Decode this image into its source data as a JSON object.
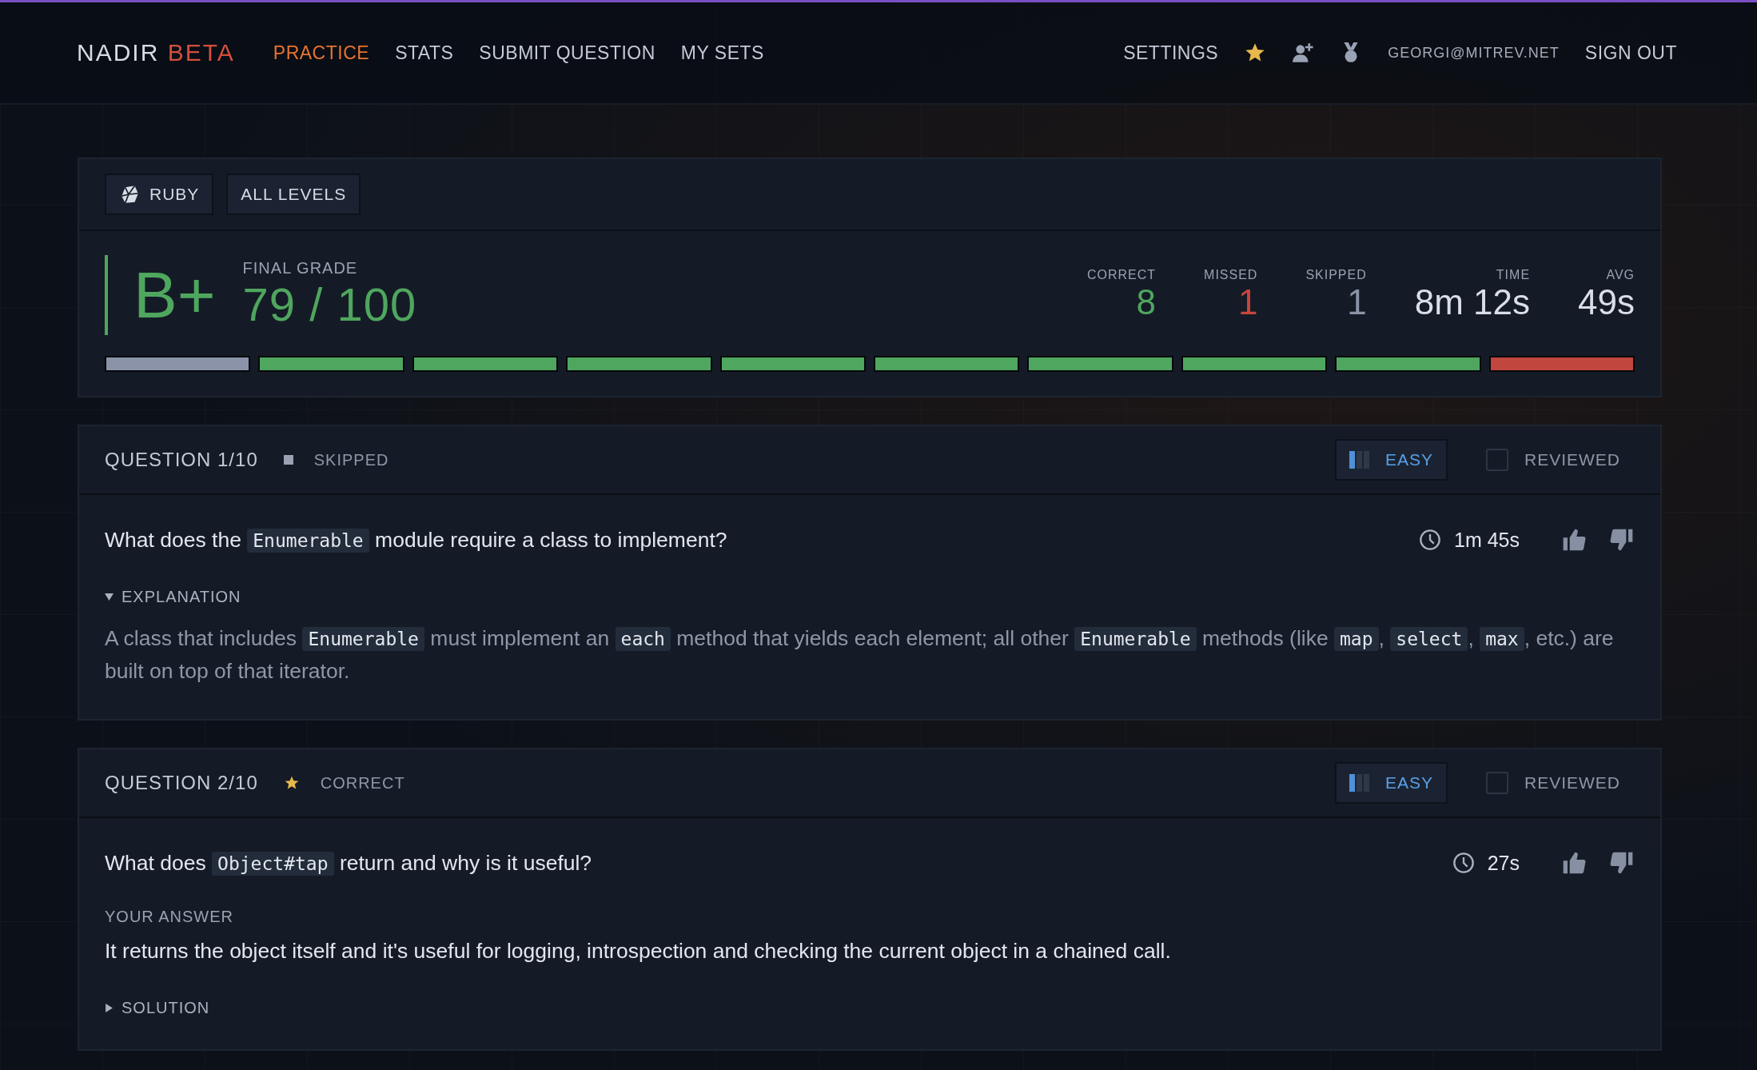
{
  "header": {
    "logo": "NADIR",
    "logo_tag": "BETA",
    "nav": [
      {
        "label": "PRACTICE",
        "selected": true
      },
      {
        "label": "STATS",
        "selected": false
      },
      {
        "label": "SUBMIT QUESTION",
        "selected": false
      },
      {
        "label": "MY SETS",
        "selected": false
      }
    ],
    "settings": "SETTINGS",
    "email": "GEORGI@MITREV.NET",
    "sign_out": "SIGN OUT"
  },
  "summary": {
    "filters": [
      {
        "label": "RUBY",
        "kind": "language"
      },
      {
        "label": "ALL LEVELS",
        "kind": "level"
      }
    ],
    "grade": "B+",
    "grade_label": "FINAL GRADE",
    "score": "79 / 100",
    "stats": [
      {
        "label": "CORRECT",
        "value": "8",
        "kind": "correct"
      },
      {
        "label": "MISSED",
        "value": "1",
        "kind": "missed"
      },
      {
        "label": "SKIPPED",
        "value": "1",
        "kind": "skipped"
      },
      {
        "label": "TIME",
        "value": "8m 12s",
        "kind": "plain"
      },
      {
        "label": "AVG",
        "value": "49s",
        "kind": "plain"
      }
    ],
    "results": [
      {
        "kind": "skipped"
      },
      {
        "kind": "correct"
      },
      {
        "kind": "correct"
      },
      {
        "kind": "correct"
      },
      {
        "kind": "correct"
      },
      {
        "kind": "correct"
      },
      {
        "kind": "correct"
      },
      {
        "kind": "correct"
      },
      {
        "kind": "correct"
      },
      {
        "kind": "missed"
      }
    ]
  },
  "questions": [
    {
      "title": "QUESTION 1/10",
      "status": "SKIPPED",
      "kind": "skipped",
      "difficulty": {
        "label": "EASY",
        "level": 0.33
      },
      "reviewed": {
        "label": "REVIEWED",
        "checked": false
      },
      "text": [
        {
          "kind": "text",
          "text": "What does the "
        },
        {
          "kind": "code",
          "text": "Enumerable"
        },
        {
          "kind": "text",
          "text": " module require a class to implement?"
        }
      ],
      "time": "1m 45s",
      "sections": [
        {
          "kind": "disclosure",
          "label": "EXPLANATION",
          "expanded": true,
          "body": [
            {
              "kind": "text",
              "text": "A class that includes "
            },
            {
              "kind": "code",
              "text": "Enumerable"
            },
            {
              "kind": "text",
              "text": " must implement an "
            },
            {
              "kind": "code",
              "text": "each"
            },
            {
              "kind": "text",
              "text": " method that yields each element; all other "
            },
            {
              "kind": "code",
              "text": "Enumerable"
            },
            {
              "kind": "text",
              "text": " methods (like "
            },
            {
              "kind": "code",
              "text": "map"
            },
            {
              "kind": "text",
              "text": ", "
            },
            {
              "kind": "code",
              "text": "select"
            },
            {
              "kind": "text",
              "text": ", "
            },
            {
              "kind": "code",
              "text": "max"
            },
            {
              "kind": "text",
              "text": ", etc.) are built on top of that iterator."
            }
          ]
        }
      ]
    },
    {
      "title": "QUESTION 2/10",
      "status": "CORRECT",
      "kind": "correct",
      "difficulty": {
        "label": "EASY",
        "level": 0.33
      },
      "reviewed": {
        "label": "REVIEWED",
        "checked": false
      },
      "text": [
        {
          "kind": "text",
          "text": "What does "
        },
        {
          "kind": "code",
          "text": "Object#tap"
        },
        {
          "kind": "text",
          "text": " return and why is it useful?"
        }
      ],
      "time": "27s",
      "sections": [
        {
          "kind": "answer",
          "label": "YOUR ANSWER",
          "text": "It returns the object itself and it's useful for logging, introspection and checking the current object in a chained call."
        },
        {
          "kind": "disclosure",
          "label": "SOLUTION",
          "expanded": false
        }
      ]
    }
  ]
}
